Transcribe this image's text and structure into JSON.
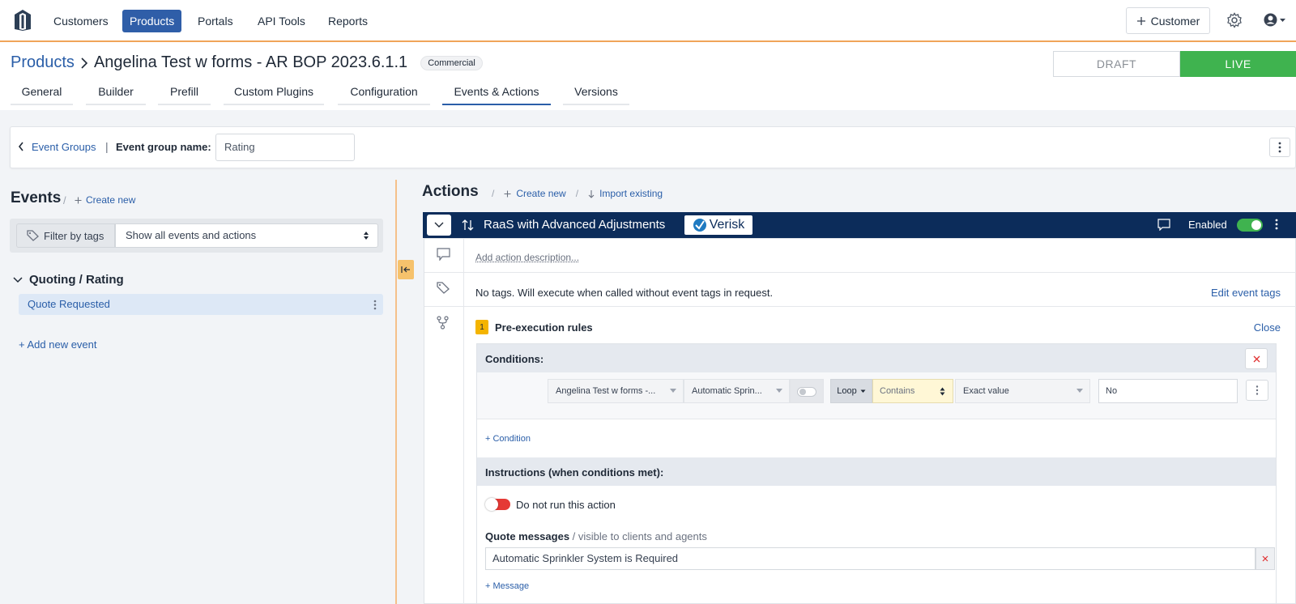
{
  "nav": {
    "items": [
      "Customers",
      "Products",
      "Portals",
      "API Tools",
      "Reports"
    ],
    "active": "Products",
    "customer_button": "Customer"
  },
  "header": {
    "breadcrumb_link": "Products",
    "title": "Angelina Test w forms - AR BOP 2023.6.1.1",
    "badge": "Commercial",
    "draft_label": "DRAFT",
    "live_label": "LIVE",
    "tabs": [
      "General",
      "Builder",
      "Prefill",
      "Custom Plugins",
      "Configuration",
      "Events & Actions",
      "Versions"
    ],
    "active_tab": "Events & Actions"
  },
  "group_bar": {
    "back_link": "Event Groups",
    "separator": "|",
    "name_label": "Event group name:",
    "name_value": "Rating"
  },
  "events": {
    "title": "Events",
    "separator": "/",
    "create_new": "Create new",
    "filter_label": "Filter by tags",
    "filter_value": "Show all events and actions",
    "group_name": "Quoting / Rating",
    "items": [
      "Quote Requested"
    ],
    "add_event": "+ Add new event"
  },
  "actions": {
    "title": "Actions",
    "separator": "/",
    "create_new": "Create new",
    "import_existing": "Import existing",
    "action_name": "RaaS with Advanced Adjustments",
    "brand": "Verisk",
    "enabled_label": "Enabled",
    "description_placeholder": "Add action description...",
    "tags_text": "No tags. Will execute when called without event tags in request.",
    "edit_tags": "Edit event tags",
    "rule_number": "1",
    "pre_rules_label": "Pre-execution rules",
    "close_label": "Close",
    "conditions_label": "Conditions:",
    "condition": {
      "source": "Angelina Test w forms -...",
      "field": "Automatic Sprin...",
      "loop": "Loop",
      "operator": "Contains",
      "value_type": "Exact value",
      "value": "No"
    },
    "add_condition": "+ Condition",
    "instructions_label": "Instructions (when conditions met):",
    "do_not_run": "Do not run this action",
    "quote_messages_label": "Quote messages",
    "quote_messages_note": " / visible to clients and agents",
    "message_value": "Automatic Sprinkler System is Required",
    "add_message": "+ Message"
  }
}
